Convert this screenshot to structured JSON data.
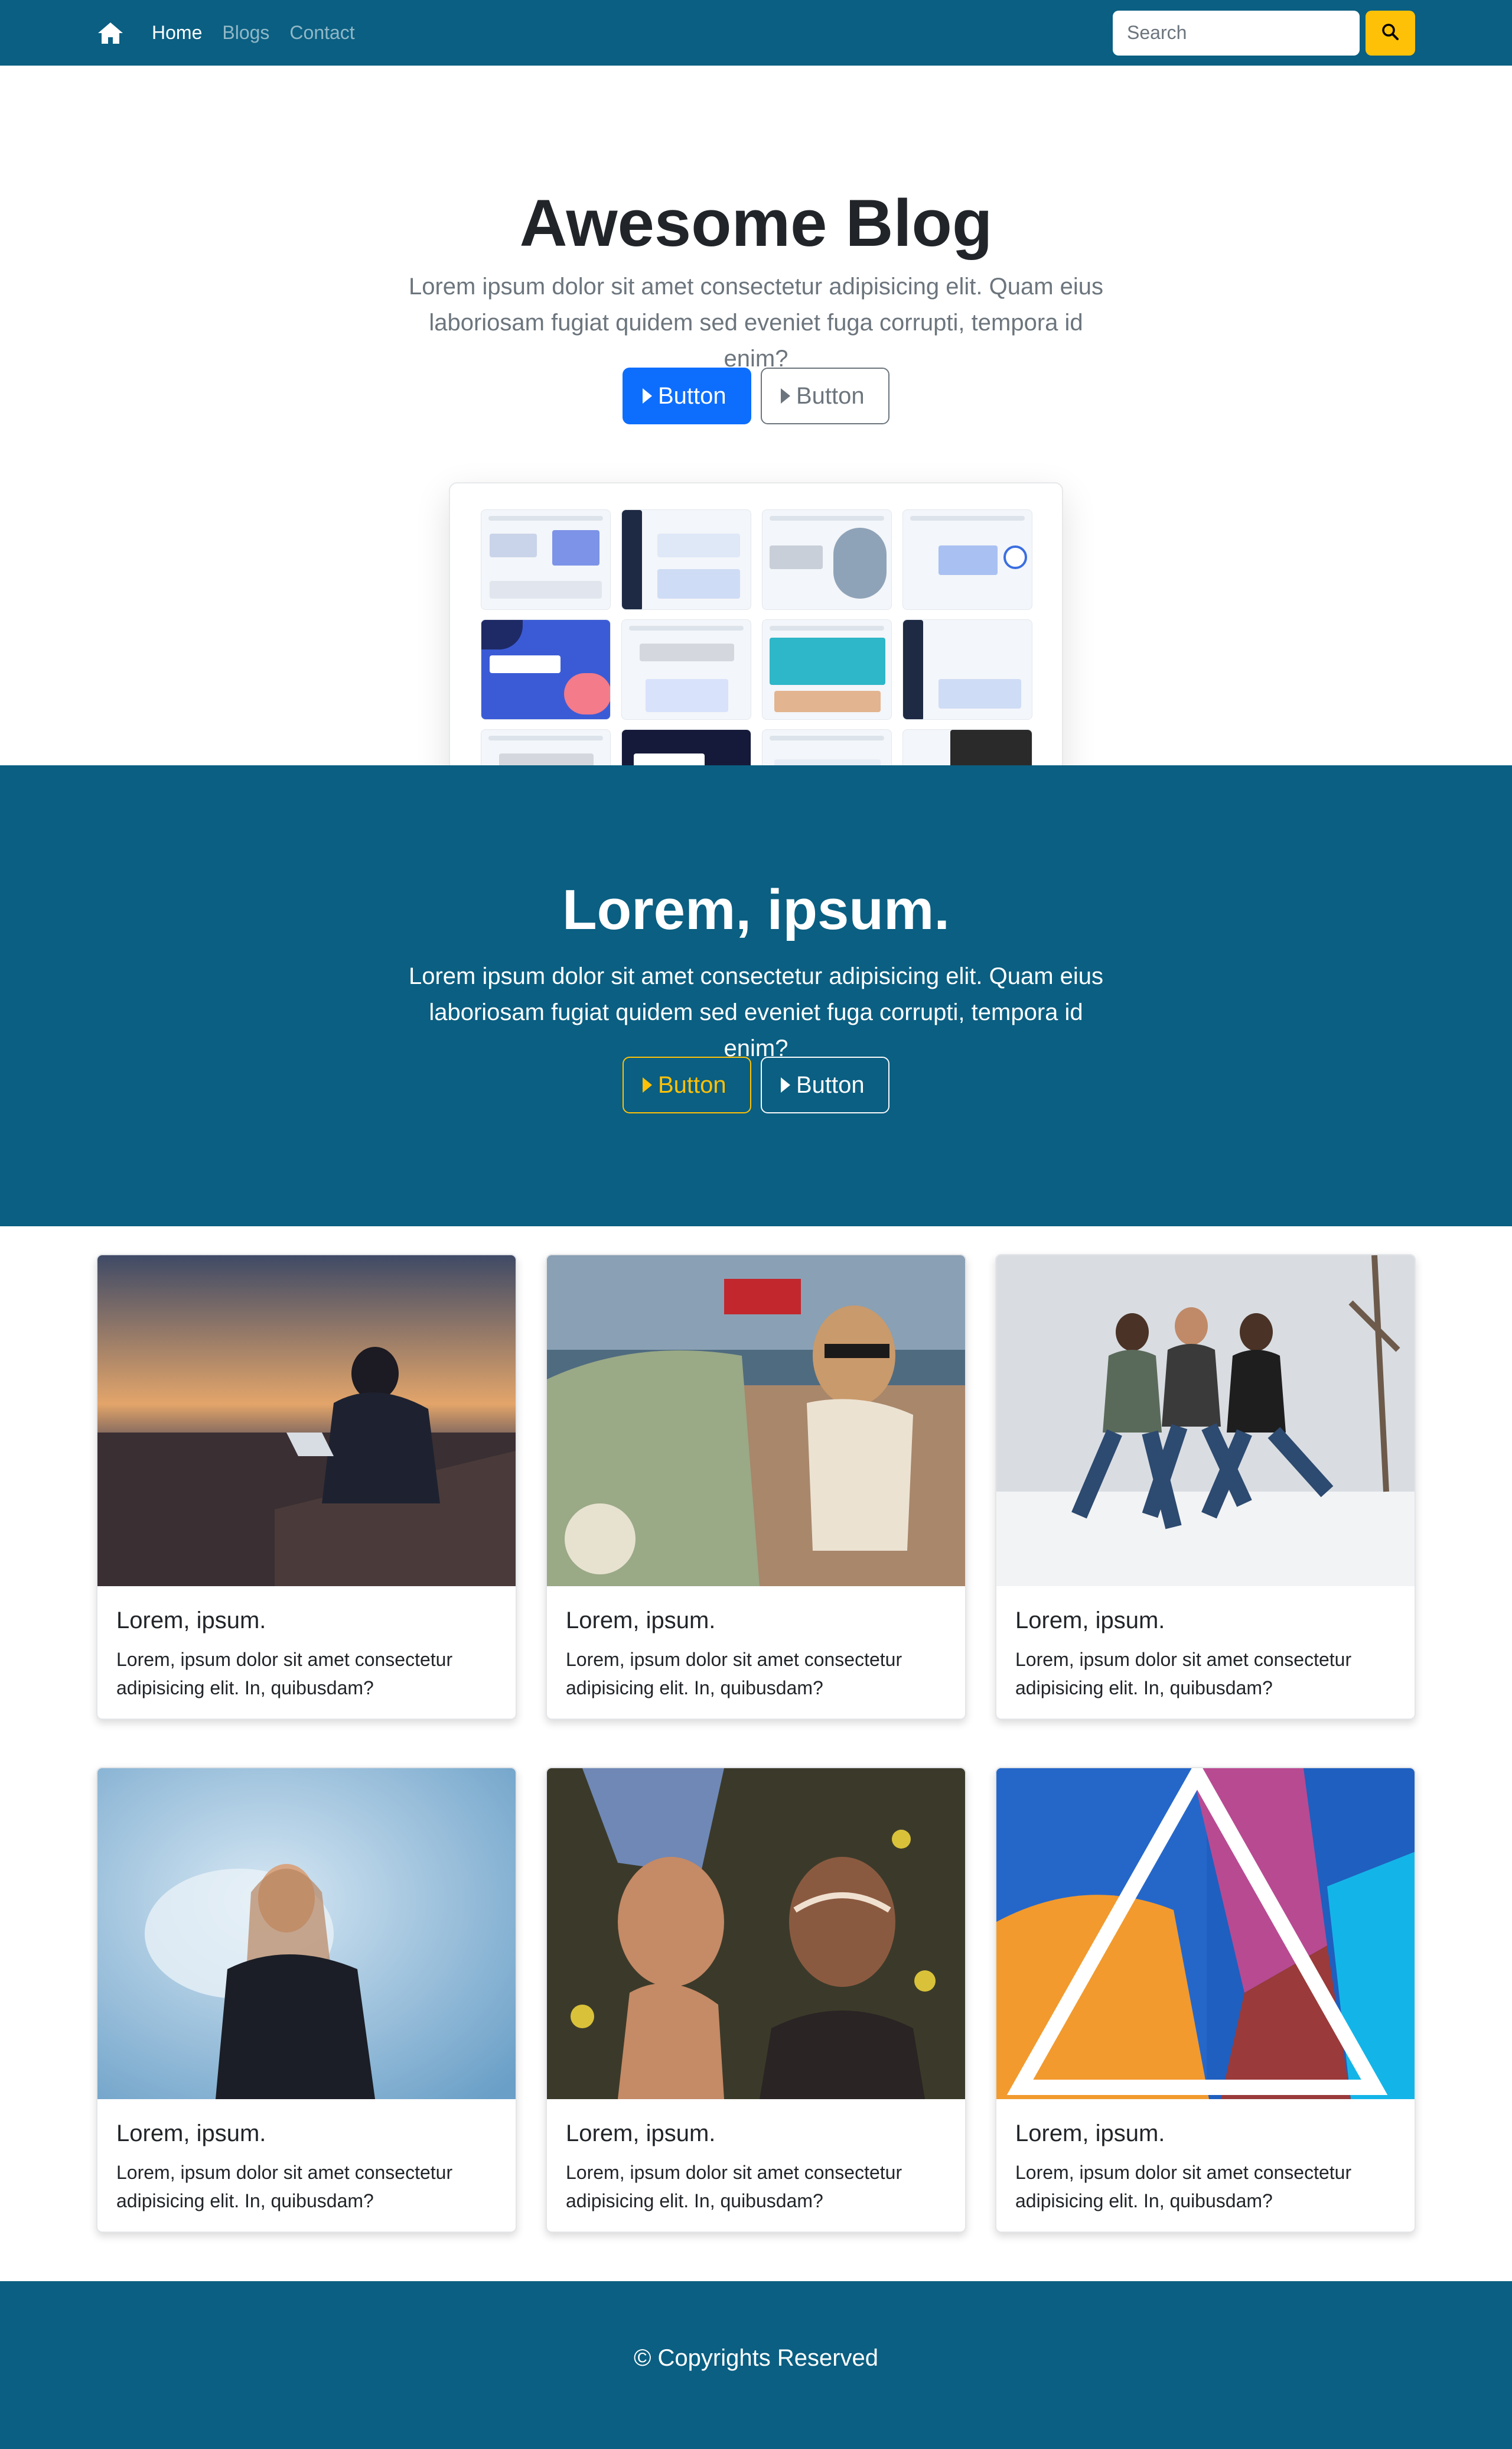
{
  "colors": {
    "brand": "#0a5f82",
    "primary": "#0d6efd",
    "warning": "#ffc107",
    "muted": "#6c757d"
  },
  "nav": {
    "home_icon": "home-icon",
    "links": [
      "Home",
      "Blogs",
      "Contact"
    ],
    "search_placeholder": "Search",
    "search_icon": "search-icon"
  },
  "hero": {
    "title": "Awesome Blog",
    "lead": "Lorem ipsum dolor sit amet consectetur adipisicing elit. Quam eius laboriosam fugiat quidem sed eveniet fuga corrupti, tempora id enim?",
    "primary_button": "Button",
    "secondary_button": "Button"
  },
  "feature": {
    "title": "Lorem, ipsum.",
    "lead": "Lorem ipsum dolor sit amet consectetur adipisicing elit. Quam eius laboriosam fugiat quidem sed eveniet fuga corrupti, tempora id enim?",
    "warning_button": "Button",
    "light_button": "Button"
  },
  "cards": [
    {
      "title": "Lorem, ipsum.",
      "text": "Lorem, ipsum dolor sit amet consectetur adipisicing elit. In, quibusdam?"
    },
    {
      "title": "Lorem, ipsum.",
      "text": "Lorem, ipsum dolor sit amet consectetur adipisicing elit. In, quibusdam?"
    },
    {
      "title": "Lorem, ipsum.",
      "text": "Lorem, ipsum dolor sit amet consectetur adipisicing elit. In, quibusdam?"
    },
    {
      "title": "Lorem, ipsum.",
      "text": "Lorem, ipsum dolor sit amet consectetur adipisicing elit. In, quibusdam?"
    },
    {
      "title": "Lorem, ipsum.",
      "text": "Lorem, ipsum dolor sit amet consectetur adipisicing elit. In, quibusdam?"
    },
    {
      "title": "Lorem, ipsum.",
      "text": "Lorem, ipsum dolor sit amet consectetur adipisicing elit. In, quibusdam?"
    }
  ],
  "footer": {
    "text": "© Copyrights Reserved"
  }
}
